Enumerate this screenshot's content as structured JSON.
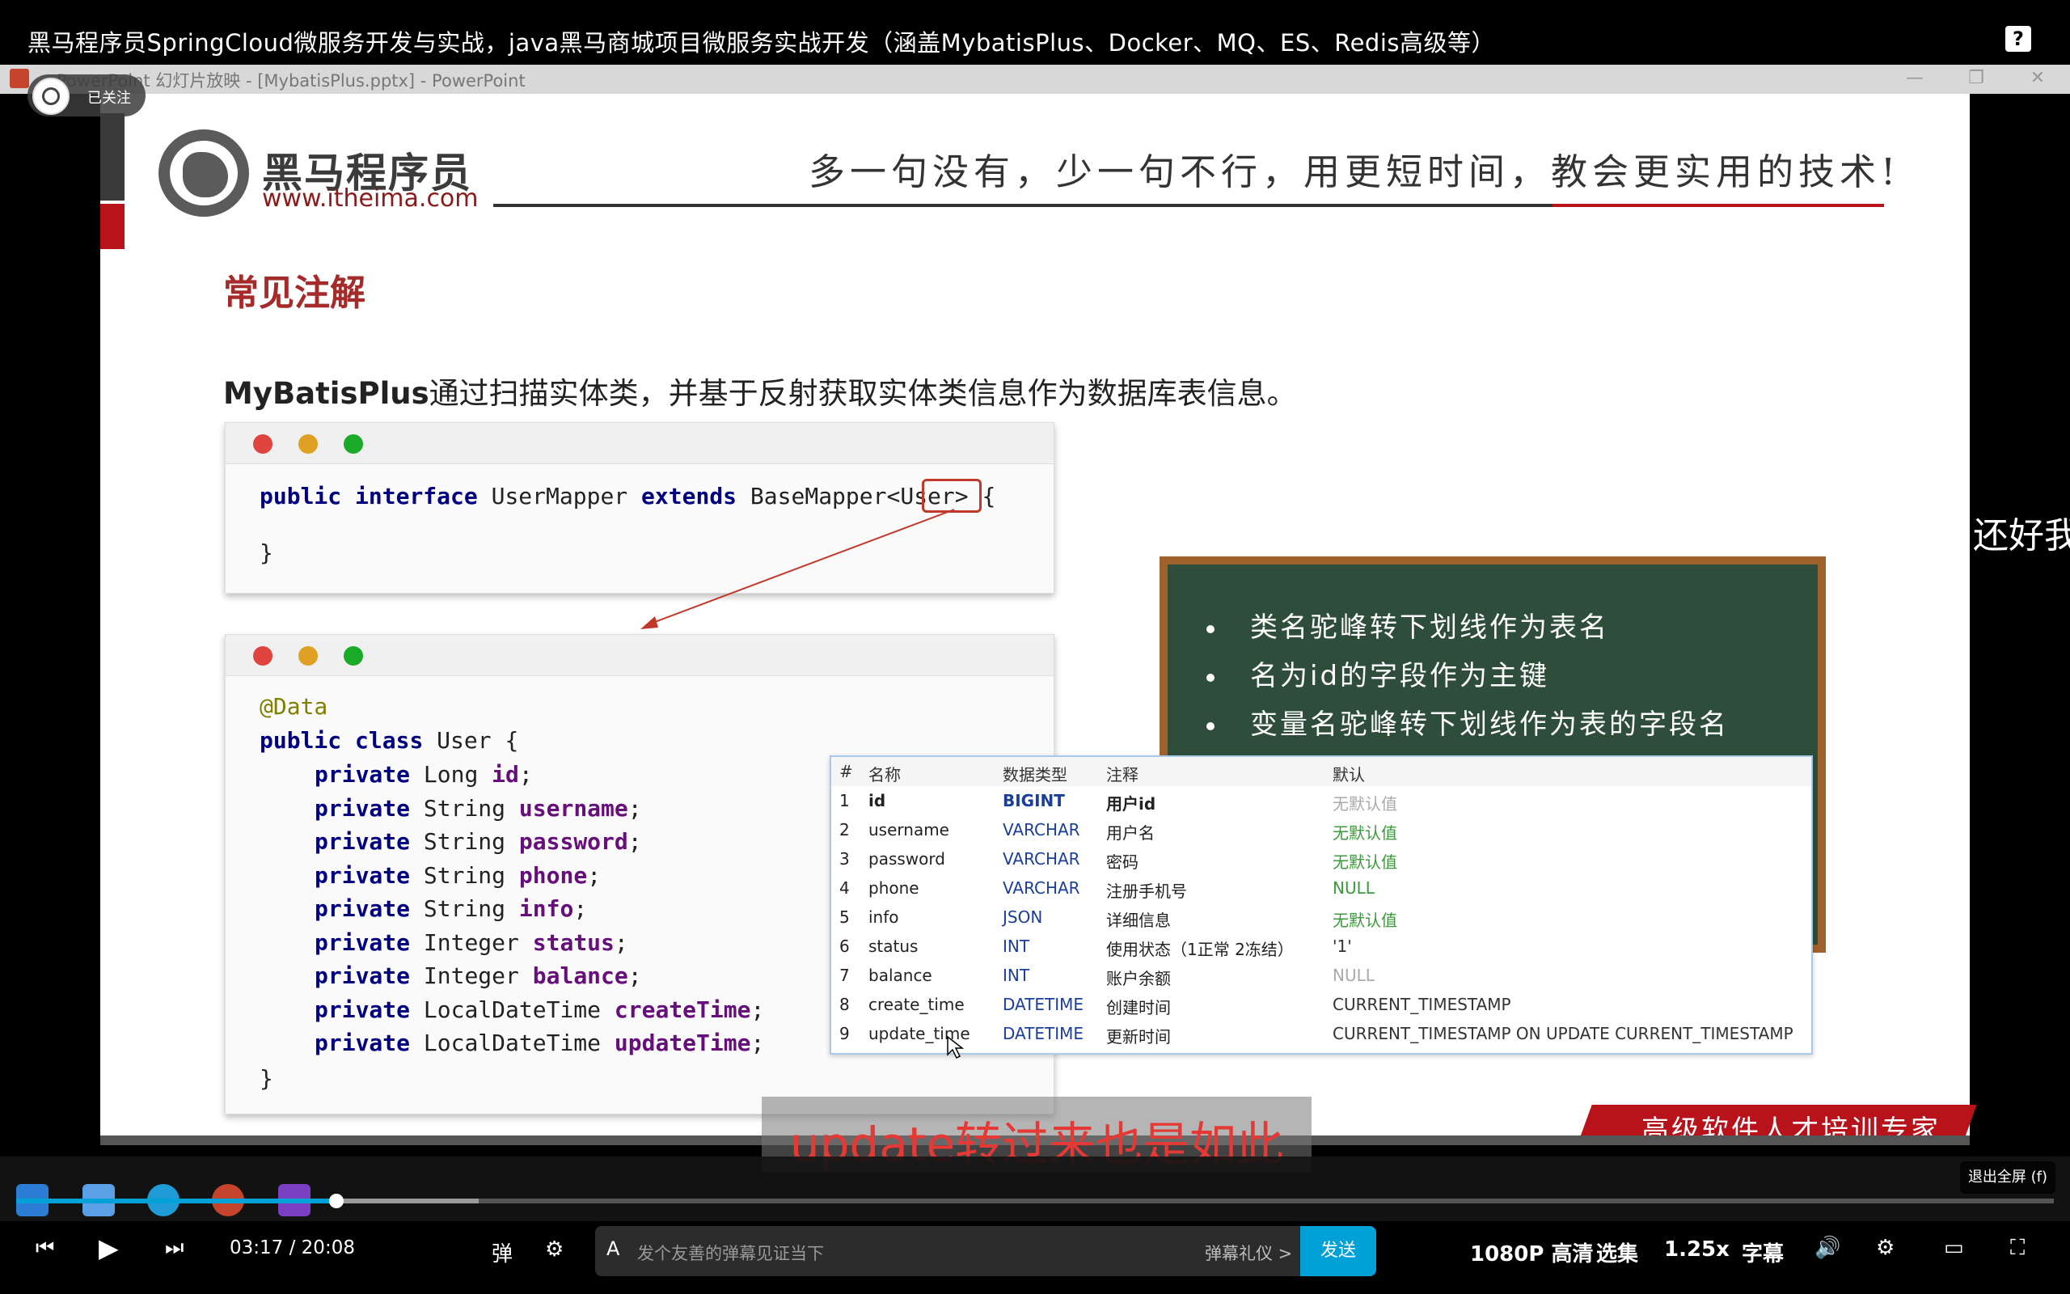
{
  "video": {
    "title": "黑马程序员SpringCloud微服务开发与实战，java黑马商城项目微服务实战开发（涵盖MybatisPlus、Docker、MQ、ES、Redis高级等）",
    "follow_label": "已关注",
    "side_overlay_text": "还好我",
    "subtitle": "update转过来也是如此"
  },
  "ppt_window": {
    "title": "PowerPoint 幻灯片放映 - [MybatisPlus.pptx] - PowerPoint"
  },
  "slide": {
    "brand_name": "黑马程序员",
    "brand_url": "www.itheima.com",
    "slogan": "多一句没有，少一句不行，用更短时间，教会更实用的技术!",
    "section_title": "常见注解",
    "intro_bold": "MyBatisPlus",
    "intro_rest": "通过扫描实体类，并基于反射获取实体类信息作为数据库表信息。",
    "footer_banner": "高级软件人才培训专家",
    "code1": {
      "line1_kw1": "public",
      "line1_kw2": "interface",
      "line1_name": " UserMapper ",
      "line1_kw3": "extends",
      "line1_rest_a": " BaseMapper<",
      "line1_user": "User",
      "line1_rest_b": "> {",
      "line2": "}"
    },
    "code2": {
      "annotation": "@Data",
      "class_kw1": "public",
      "class_kw2": "class",
      "class_name": " User {",
      "fields": [
        {
          "type": "Long",
          "name": "id"
        },
        {
          "type": "String",
          "name": "username"
        },
        {
          "type": "String",
          "name": "password"
        },
        {
          "type": "String",
          "name": "phone"
        },
        {
          "type": "String",
          "name": "info"
        },
        {
          "type": "Integer",
          "name": "status"
        },
        {
          "type": "Integer",
          "name": "balance"
        },
        {
          "type": "LocalDateTime",
          "name": "createTime"
        },
        {
          "type": "LocalDateTime",
          "name": "updateTime"
        }
      ],
      "private_kw": "private",
      "closing": "}"
    },
    "board_bullets": [
      "类名驼峰转下划线作为表名",
      "名为id的字段作为主键",
      "变量名驼峰转下划线作为表的字段名"
    ],
    "db_table": {
      "headers": [
        "#",
        "名称",
        "数据类型",
        "注释",
        "默认"
      ],
      "rows": [
        [
          "1",
          "id",
          "BIGINT",
          "用户id",
          "无默认值"
        ],
        [
          "2",
          "username",
          "VARCHAR",
          "用户名",
          "无默认值"
        ],
        [
          "3",
          "password",
          "VARCHAR",
          "密码",
          "无默认值"
        ],
        [
          "4",
          "phone",
          "VARCHAR",
          "注册手机号",
          "NULL"
        ],
        [
          "5",
          "info",
          "JSON",
          "详细信息",
          "无默认值"
        ],
        [
          "6",
          "status",
          "INT",
          "使用状态（1正常 2冻结）",
          "'1'"
        ],
        [
          "7",
          "balance",
          "INT",
          "账户余额",
          "NULL"
        ],
        [
          "8",
          "create_time",
          "DATETIME",
          "创建时间",
          "CURRENT_TIMESTAMP"
        ],
        [
          "9",
          "update_time",
          "DATETIME",
          "更新时间",
          "CURRENT_TIMESTAMP ON UPDATE CURRENT_TIMESTAMP"
        ]
      ]
    }
  },
  "player": {
    "current_time": "03:17",
    "duration": "20:08",
    "progress_fraction": 0.157,
    "buffered_fraction": 0.227,
    "danmaku_placeholder": "发个友善的弹幕见证当下",
    "danmaku_etiquette": "弹幕礼仪 >",
    "send_label": "发送",
    "quality_label": "1080P 高清",
    "episodes_label": "选集",
    "speed_label": "1.25x",
    "cc_label": "字幕",
    "exit_fullscreen_label": "退出全屏 (f)"
  },
  "colors": {
    "accent_blue": "#00a1d6",
    "brand_red": "#b8121b",
    "board_green": "#2f4d3b",
    "subtitle_red": "#e53935"
  }
}
